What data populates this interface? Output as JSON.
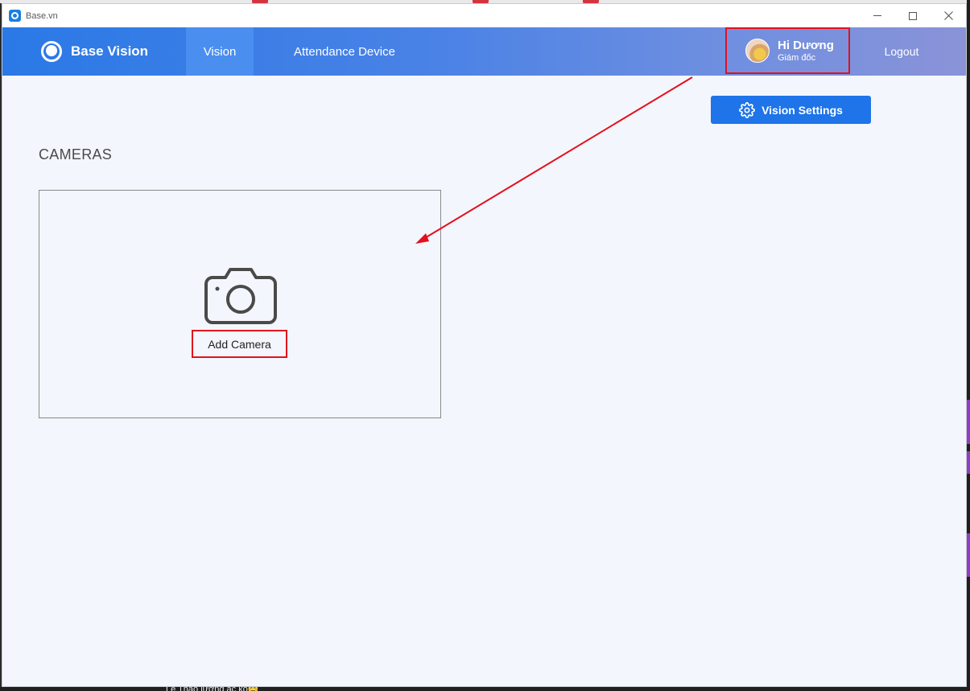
{
  "window": {
    "title": "Base.vn"
  },
  "navbar": {
    "brand": "Base Vision",
    "tabs": [
      {
        "label": "Vision",
        "active": true
      },
      {
        "label": "Attendance Device",
        "active": false
      }
    ],
    "user": {
      "greeting": "Hi Dương",
      "role": "Giám đốc"
    },
    "logout_label": "Logout"
  },
  "toolbar": {
    "settings_label": "Vision Settings"
  },
  "main": {
    "section_title": "CAMERAS",
    "add_camera_label": "Add Camera"
  },
  "background": {
    "bottom_text": "Lê Thảo lương ạc kọ😊"
  },
  "colors": {
    "primary": "#1e74e8",
    "annotation": "#e3101e",
    "page_bg": "#f3f6fc"
  },
  "icons": [
    "app-logo-icon",
    "brand-logo-icon",
    "gear-icon",
    "camera-icon",
    "minimize-icon",
    "maximize-icon",
    "close-icon"
  ]
}
